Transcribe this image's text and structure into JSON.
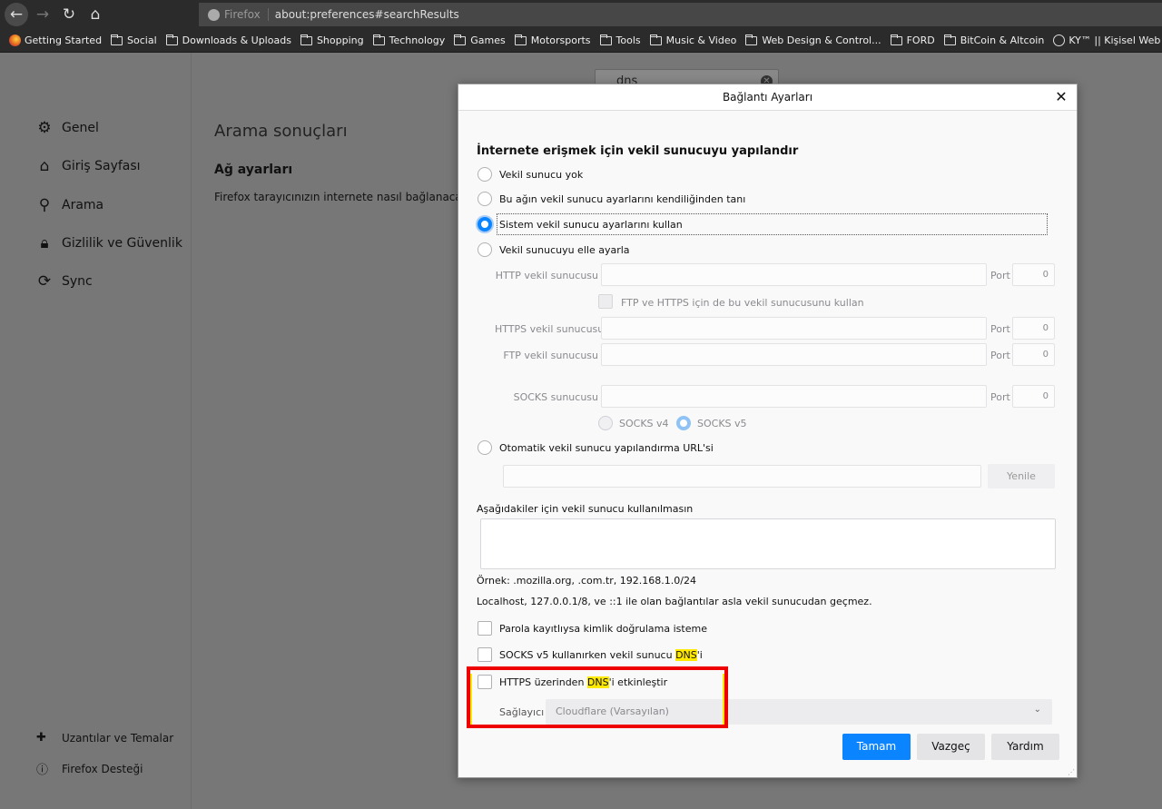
{
  "toolbar": {
    "back_icon": "arrow-left-icon",
    "forward_icon": "arrow-right-icon",
    "reload_icon": "reload-icon",
    "home_icon": "home-icon",
    "identity_label": "Firefox",
    "url": "about:preferences#searchResults"
  },
  "bookmarks": [
    {
      "label": "Getting Started",
      "icon": "firefox-icon"
    },
    {
      "label": "Social",
      "icon": "folder-icon"
    },
    {
      "label": "Downloads & Uploads",
      "icon": "folder-icon"
    },
    {
      "label": "Shopping",
      "icon": "folder-icon"
    },
    {
      "label": "Technology",
      "icon": "folder-icon"
    },
    {
      "label": "Games",
      "icon": "folder-icon"
    },
    {
      "label": "Motorsports",
      "icon": "folder-icon"
    },
    {
      "label": "Tools",
      "icon": "folder-icon"
    },
    {
      "label": "Music & Video",
      "icon": "folder-icon"
    },
    {
      "label": "Web Design & Control...",
      "icon": "folder-icon"
    },
    {
      "label": "FORD",
      "icon": "folder-icon"
    },
    {
      "label": "BitCoin & Altcoin",
      "icon": "folder-icon"
    },
    {
      "label": "KY™ || Kişisel Web Sitesi",
      "icon": "globe-icon"
    }
  ],
  "sidebar": {
    "items": [
      {
        "label": "Genel",
        "icon": "gear-icon"
      },
      {
        "label": "Giriş Sayfası",
        "icon": "home-icon"
      },
      {
        "label": "Arama",
        "icon": "search-icon"
      },
      {
        "label": "Gizlilik ve Güvenlik",
        "icon": "lock-icon"
      },
      {
        "label": "Sync",
        "icon": "sync-icon"
      }
    ],
    "footer": [
      {
        "label": "Uzantılar ve Temalar",
        "icon": "puzzle-icon"
      },
      {
        "label": "Firefox Desteği",
        "icon": "help-icon"
      }
    ]
  },
  "main": {
    "search_value": "dns",
    "title": "Arama sonuçları",
    "section_title": "Ağ ayarları",
    "section_desc": "Firefox tarayıcınızın internete nasıl bağlanacağ"
  },
  "dialog": {
    "title": "Bağlantı Ayarları",
    "heading": "İnternete erişmek için vekil sunucuyu yapılandır",
    "options": {
      "none": "Vekil sunucu yok",
      "auto_detect": "Bu ağın vekil sunucu ayarlarını kendiliğinden tanı",
      "system": "Sistem vekil sunucu ayarlarını kullan",
      "manual": "Vekil sunucuyu elle ayarla",
      "pac": "Otomatik vekil sunucu yapılandırma URL'si"
    },
    "selected_option": "system",
    "manual": {
      "http_label": "HTTP vekil sunucusu",
      "https_label": "HTTPS vekil sunucusu",
      "ftp_label": "FTP vekil sunucusu",
      "socks_label": "SOCKS sunucusu",
      "port_label": "Port",
      "port_value": "0",
      "share_label": "FTP ve HTTPS için de bu vekil sunucusunu kullan",
      "socks_v4": "SOCKS v4",
      "socks_v5": "SOCKS v5"
    },
    "reload_button": "Yenile",
    "no_proxy_label": "Aşağıdakiler için vekil sunucu kullanılmasın",
    "example_text": "Örnek: .mozilla.org, .com.tr, 192.168.1.0/24",
    "localhost_text": "Localhost, 127.0.0.1/8, ve ::1 ile olan bağlantılar asla vekil sunucudan geçmez.",
    "checkboxes": {
      "autologin": "Parola kayıtlıysa kimlik doğrulama isteme",
      "socks_dns_prefix": "SOCKS v5 kullanırken vekil sunucu ",
      "socks_dns_hl": "DNS",
      "socks_dns_suffix": "'i",
      "doh_prefix": "HTTPS üzerinden ",
      "doh_hl": "DNS",
      "doh_suffix": "'i etkinleştir"
    },
    "provider_label": "Sağlayıcı",
    "provider_value": "Cloudflare (Varsayılan)",
    "buttons": {
      "ok": "Tamam",
      "cancel": "Vazgeç",
      "help": "Yardım"
    }
  },
  "colors": {
    "accent": "#0a84ff",
    "highlight": "#ffe900",
    "annotation": "#e00000"
  }
}
